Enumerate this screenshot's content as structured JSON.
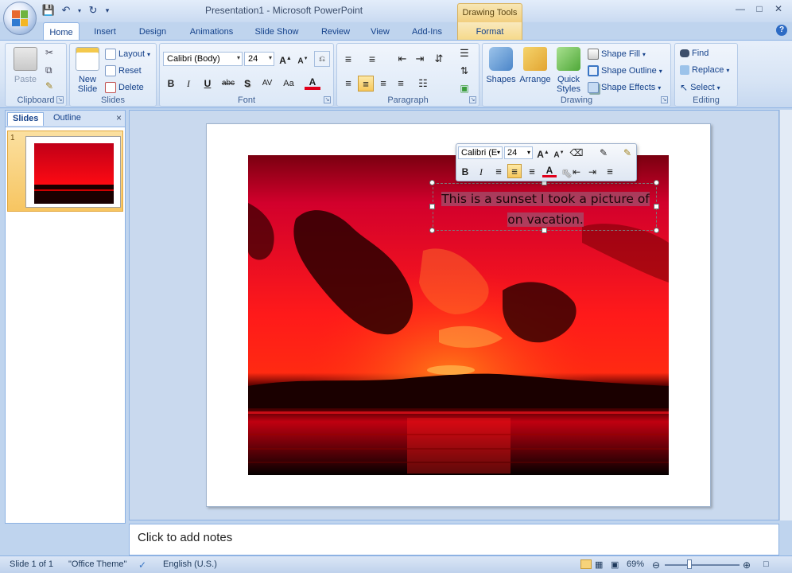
{
  "window": {
    "title": "Presentation1 - Microsoft PowerPoint",
    "contextual_tab_group": "Drawing Tools"
  },
  "ribbon_tabs": [
    "Home",
    "Insert",
    "Design",
    "Animations",
    "Slide Show",
    "Review",
    "View",
    "Add-Ins",
    "Format"
  ],
  "ribbon": {
    "clipboard": {
      "label": "Clipboard",
      "paste": "Paste"
    },
    "slides": {
      "label": "Slides",
      "new_slide": "New Slide",
      "layout": "Layout",
      "reset": "Reset",
      "delete": "Delete"
    },
    "font": {
      "label": "Font",
      "font_name": "Calibri (Body)",
      "font_size": "24",
      "bold": "B",
      "italic": "I",
      "underline": "U",
      "strike": "abc",
      "shadow": "S",
      "spacing": "AV",
      "case": "Aa",
      "color": "A"
    },
    "paragraph": {
      "label": "Paragraph"
    },
    "drawing": {
      "label": "Drawing",
      "shapes": "Shapes",
      "arrange": "Arrange",
      "quick_styles": "Quick Styles",
      "shape_fill": "Shape Fill",
      "shape_outline": "Shape Outline",
      "shape_effects": "Shape Effects"
    },
    "editing": {
      "label": "Editing",
      "find": "Find",
      "replace": "Replace",
      "select": "Select"
    }
  },
  "left_panel": {
    "tabs": [
      "Slides",
      "Outline"
    ],
    "close": "×",
    "slide_number": "1"
  },
  "slide": {
    "caption": "This is a sunset I took a picture of on vacation."
  },
  "mini_toolbar": {
    "font_name": "Calibri (E",
    "font_size": "24",
    "bold": "B",
    "italic": "I",
    "color": "A"
  },
  "notes": {
    "placeholder": "Click to add notes"
  },
  "status_bar": {
    "slide_info": "Slide 1 of 1",
    "theme": "\"Office Theme\"",
    "language": "English (U.S.)",
    "zoom": "69%"
  },
  "colors": {
    "ribbon_bg": "#dce8f7",
    "accent_orange": "#f7c561",
    "sunset_red": "#e10015"
  }
}
